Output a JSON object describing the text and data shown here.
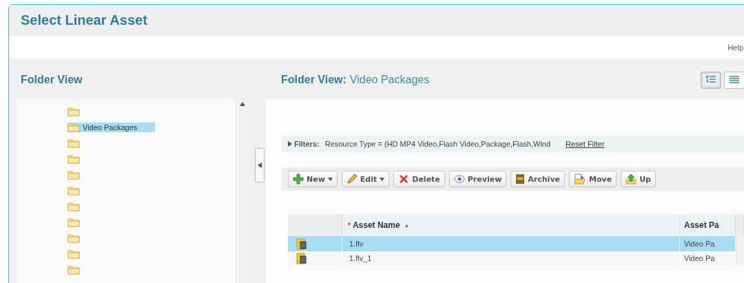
{
  "dialog": {
    "title": "Select Linear Asset",
    "help": "Help"
  },
  "left_panel": {
    "title": "Folder View",
    "tree": [
      {
        "selected": false
      },
      {
        "label": "Video Packages",
        "selected": true
      },
      {
        "selected": false
      },
      {
        "selected": false
      },
      {
        "selected": false
      },
      {
        "selected": false
      },
      {
        "selected": false
      },
      {
        "selected": false
      },
      {
        "selected": false
      },
      {
        "selected": false
      },
      {
        "selected": false
      }
    ]
  },
  "right_panel": {
    "title": "Folder View:",
    "folder": "Video Packages",
    "view_buttons": [
      {
        "kind": "tree",
        "selected": true
      },
      {
        "kind": "list",
        "selected": false
      }
    ],
    "filters": {
      "label": "Filters:",
      "value": "Resource Type = (HD MP4 Video,Flash Video,Package,Flash,Wind",
      "reset": "Reset Filter"
    },
    "toolbar": [
      {
        "kind": "new",
        "label": "New",
        "dropdown": true
      },
      {
        "kind": "edit",
        "label": "Edit",
        "dropdown": true
      },
      {
        "kind": "delete",
        "label": "Delete",
        "dropdown": false
      },
      {
        "kind": "preview",
        "label": "Preview",
        "dropdown": false
      },
      {
        "kind": "archive",
        "label": "Archive",
        "dropdown": false
      },
      {
        "kind": "move",
        "label": "Move",
        "dropdown": false
      },
      {
        "kind": "up",
        "label": "Up",
        "dropdown": false
      }
    ],
    "table": {
      "columns": [
        {
          "label": "Asset Name",
          "required": "*",
          "sort": "▲"
        },
        {
          "label": "Asset Pa"
        }
      ],
      "rows": [
        {
          "name": "1.flv",
          "path": "Video Pa",
          "selected": true
        },
        {
          "name": "1.flv_1",
          "path": "Video Pa",
          "selected": false
        }
      ]
    }
  }
}
